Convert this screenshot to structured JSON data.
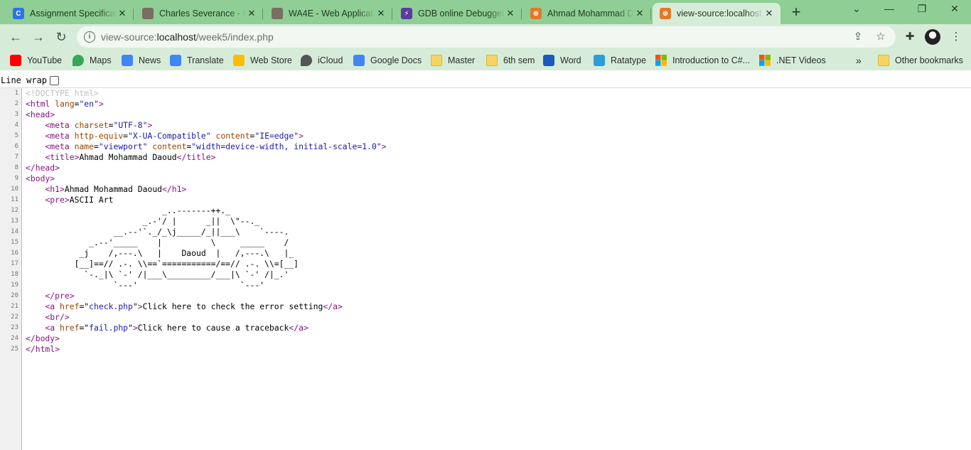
{
  "tabs": [
    {
      "title": "Assignment Specificat",
      "favicon": "coursera-icon",
      "fav_color": "#2a73e8",
      "fav_letter": "C"
    },
    {
      "title": "Charles Severance - Re",
      "favicon": "person-icon",
      "fav_color": "#7a6d62",
      "fav_letter": ""
    },
    {
      "title": "WA4E - Web Applicat",
      "favicon": "person-icon",
      "fav_color": "#7a6d62",
      "fav_letter": ""
    },
    {
      "title": "GDB online Debugger",
      "favicon": "bolt-icon",
      "fav_color": "#5b3b9e",
      "fav_letter": "⚡"
    },
    {
      "title": "Ahmad Mohammad D",
      "favicon": "xampp-icon",
      "fav_color": "#e4782c",
      "fav_letter": "⊗"
    },
    {
      "title": "view-source:localhost",
      "favicon": "xampp-icon",
      "fav_color": "#e4782c",
      "fav_letter": "⊗"
    }
  ],
  "toolbar": {
    "url_scheme": "view-source:",
    "url_host": "localhost",
    "url_path": "/week5/index.php"
  },
  "bookmarks": [
    {
      "label": "YouTube",
      "icon": "youtube-icon",
      "color": "#ff0000"
    },
    {
      "label": "Maps",
      "icon": "maps-icon",
      "color": "#34a853"
    },
    {
      "label": "News",
      "icon": "news-icon",
      "color": "#4285f4"
    },
    {
      "label": "Translate",
      "icon": "translate-icon",
      "color": "#4285f4"
    },
    {
      "label": "Web Store",
      "icon": "webstore-icon",
      "color": "#fbbc04"
    },
    {
      "label": "iCloud",
      "icon": "apple-icon",
      "color": "#555555"
    },
    {
      "label": "Google Docs",
      "icon": "docs-icon",
      "color": "#4285f4"
    },
    {
      "label": "Master",
      "icon": "folder-icon",
      "color": "#f6d463"
    },
    {
      "label": "6th sem",
      "icon": "folder-icon",
      "color": "#f6d463"
    },
    {
      "label": "Word",
      "icon": "word-icon",
      "color": "#185abd"
    },
    {
      "label": "Ratatype",
      "icon": "ratatype-icon",
      "color": "#2d9cdb"
    },
    {
      "label": "Introduction to C#...",
      "icon": "microsoft-icon",
      "color": "#f25022"
    },
    {
      "label": ".NET Videos",
      "icon": "microsoft-icon",
      "color": "#f25022"
    }
  ],
  "bookmarks_overflow": "»",
  "other_bookmarks": "Other bookmarks",
  "source_view": {
    "line_wrap_label": "Line wrap",
    "line_wrap_checked": false,
    "lines": [
      "<!DOCTYPE html>",
      "<html lang=\"en\">",
      "<head>",
      "    <meta charset=\"UTF-8\">",
      "    <meta http-equiv=\"X-UA-Compatible\" content=\"IE=edge\">",
      "    <meta name=\"viewport\" content=\"width=device-width, initial-scale=1.0\">",
      "    <title>Ahmad Mohammad Daoud</title>",
      "</head>",
      "<body>",
      "    <h1>Ahmad Mohammad Daoud</h1>",
      "    <pre>ASCII Art",
      "                            _..-------++._",
      "                        _.-'/ |      _||  \\\"--._",
      "                  __.--'`._/_\\j_____/_||___\\    `----.",
      "             _.--'_____    |          \\     _____    /",
      "           _j    /,---.\\   |    Daoud  |   /,---.\\   |_",
      "          [__]==// .-. \\\\==`===========/==// .-. \\\\=[__]",
      "            `-._|\\ `-' /|___\\_________/___|\\ `-' /|_.'",
      "                  `---'                     `---'",
      "    </pre>",
      "    <a href=\"check.php\">Click here to check the error setting</a>",
      "    <br/>",
      "    <a href=\"fail.php\">Click here to cause a traceback</a>",
      "</body>",
      "</html>"
    ]
  }
}
